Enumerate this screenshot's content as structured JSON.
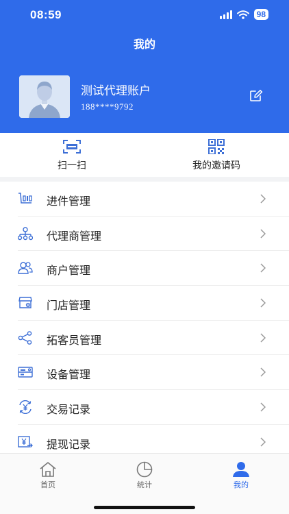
{
  "status_bar": {
    "time": "08:59",
    "battery": "98"
  },
  "header": {
    "title": "我的",
    "user_name": "测试代理账户",
    "user_phone": "188****9792"
  },
  "quick_actions": [
    {
      "label": "扫一扫",
      "icon": "scan-icon"
    },
    {
      "label": "我的邀请码",
      "icon": "qr-code-icon"
    }
  ],
  "menu": [
    {
      "label": "进件管理",
      "icon": "application-icon"
    },
    {
      "label": "代理商管理",
      "icon": "org-chart-icon"
    },
    {
      "label": "商户管理",
      "icon": "merchant-icon"
    },
    {
      "label": "门店管理",
      "icon": "store-icon"
    },
    {
      "label": "拓客员管理",
      "icon": "share-icon"
    },
    {
      "label": "设备管理",
      "icon": "device-icon"
    },
    {
      "label": "交易记录",
      "icon": "transaction-icon"
    },
    {
      "label": "提现记录",
      "icon": "withdraw-icon"
    }
  ],
  "tabs": [
    {
      "label": "首页",
      "icon": "home-icon",
      "active": false
    },
    {
      "label": "统计",
      "icon": "pie-chart-icon",
      "active": false
    },
    {
      "label": "我的",
      "icon": "profile-icon",
      "active": true
    }
  ],
  "colors": {
    "brand": "#2f6bea",
    "icon": "#3d6fd6"
  }
}
